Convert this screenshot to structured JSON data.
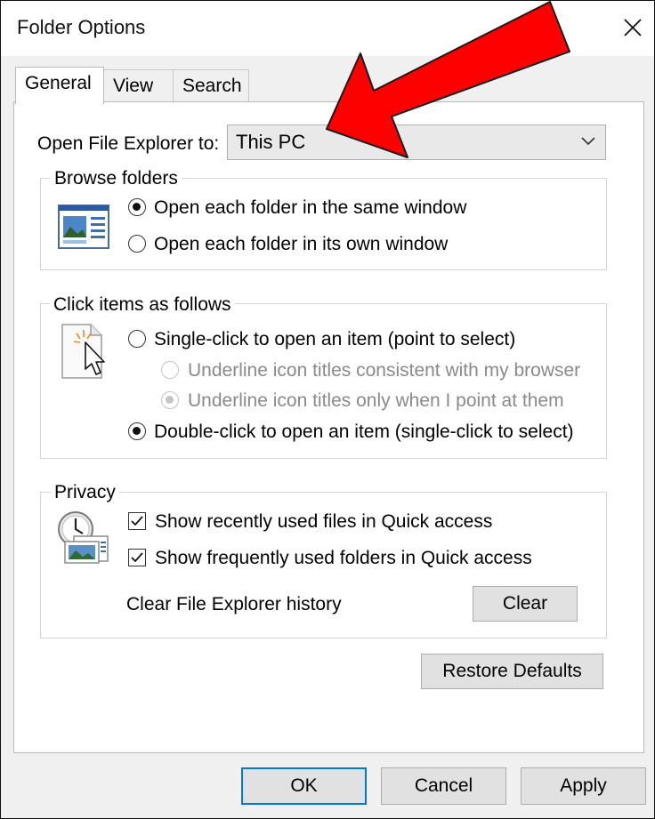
{
  "window": {
    "title": "Folder Options"
  },
  "tabs": [
    {
      "label": "General",
      "active": true
    },
    {
      "label": "View",
      "active": false
    },
    {
      "label": "Search",
      "active": false
    }
  ],
  "general": {
    "open_explorer_label": "Open File Explorer to:",
    "open_explorer_value": "This PC",
    "browse_folders": {
      "title": "Browse folders",
      "options": [
        {
          "label": "Open each folder in the same window",
          "selected": true
        },
        {
          "label": "Open each folder in its own window",
          "selected": false
        }
      ]
    },
    "click_items": {
      "title": "Click items as follows",
      "single_click": {
        "label": "Single-click to open an item (point to select)",
        "selected": false
      },
      "underline_browser": {
        "label": "Underline icon titles consistent with my browser",
        "selected": false,
        "enabled": false
      },
      "underline_point": {
        "label": "Underline icon titles only when I point at them",
        "selected": true,
        "enabled": false
      },
      "double_click": {
        "label": "Double-click to open an item (single-click to select)",
        "selected": true
      }
    },
    "privacy": {
      "title": "Privacy",
      "recent_files": {
        "label": "Show recently used files in Quick access",
        "checked": true
      },
      "frequent_folders": {
        "label": "Show frequently used folders in Quick access",
        "checked": true
      },
      "clear_history_label": "Clear File Explorer history",
      "clear_button": "Clear"
    },
    "restore_defaults": "Restore Defaults"
  },
  "footer": {
    "ok": "OK",
    "cancel": "Cancel",
    "apply": "Apply"
  },
  "annotation": {
    "color": "#ff0000"
  }
}
